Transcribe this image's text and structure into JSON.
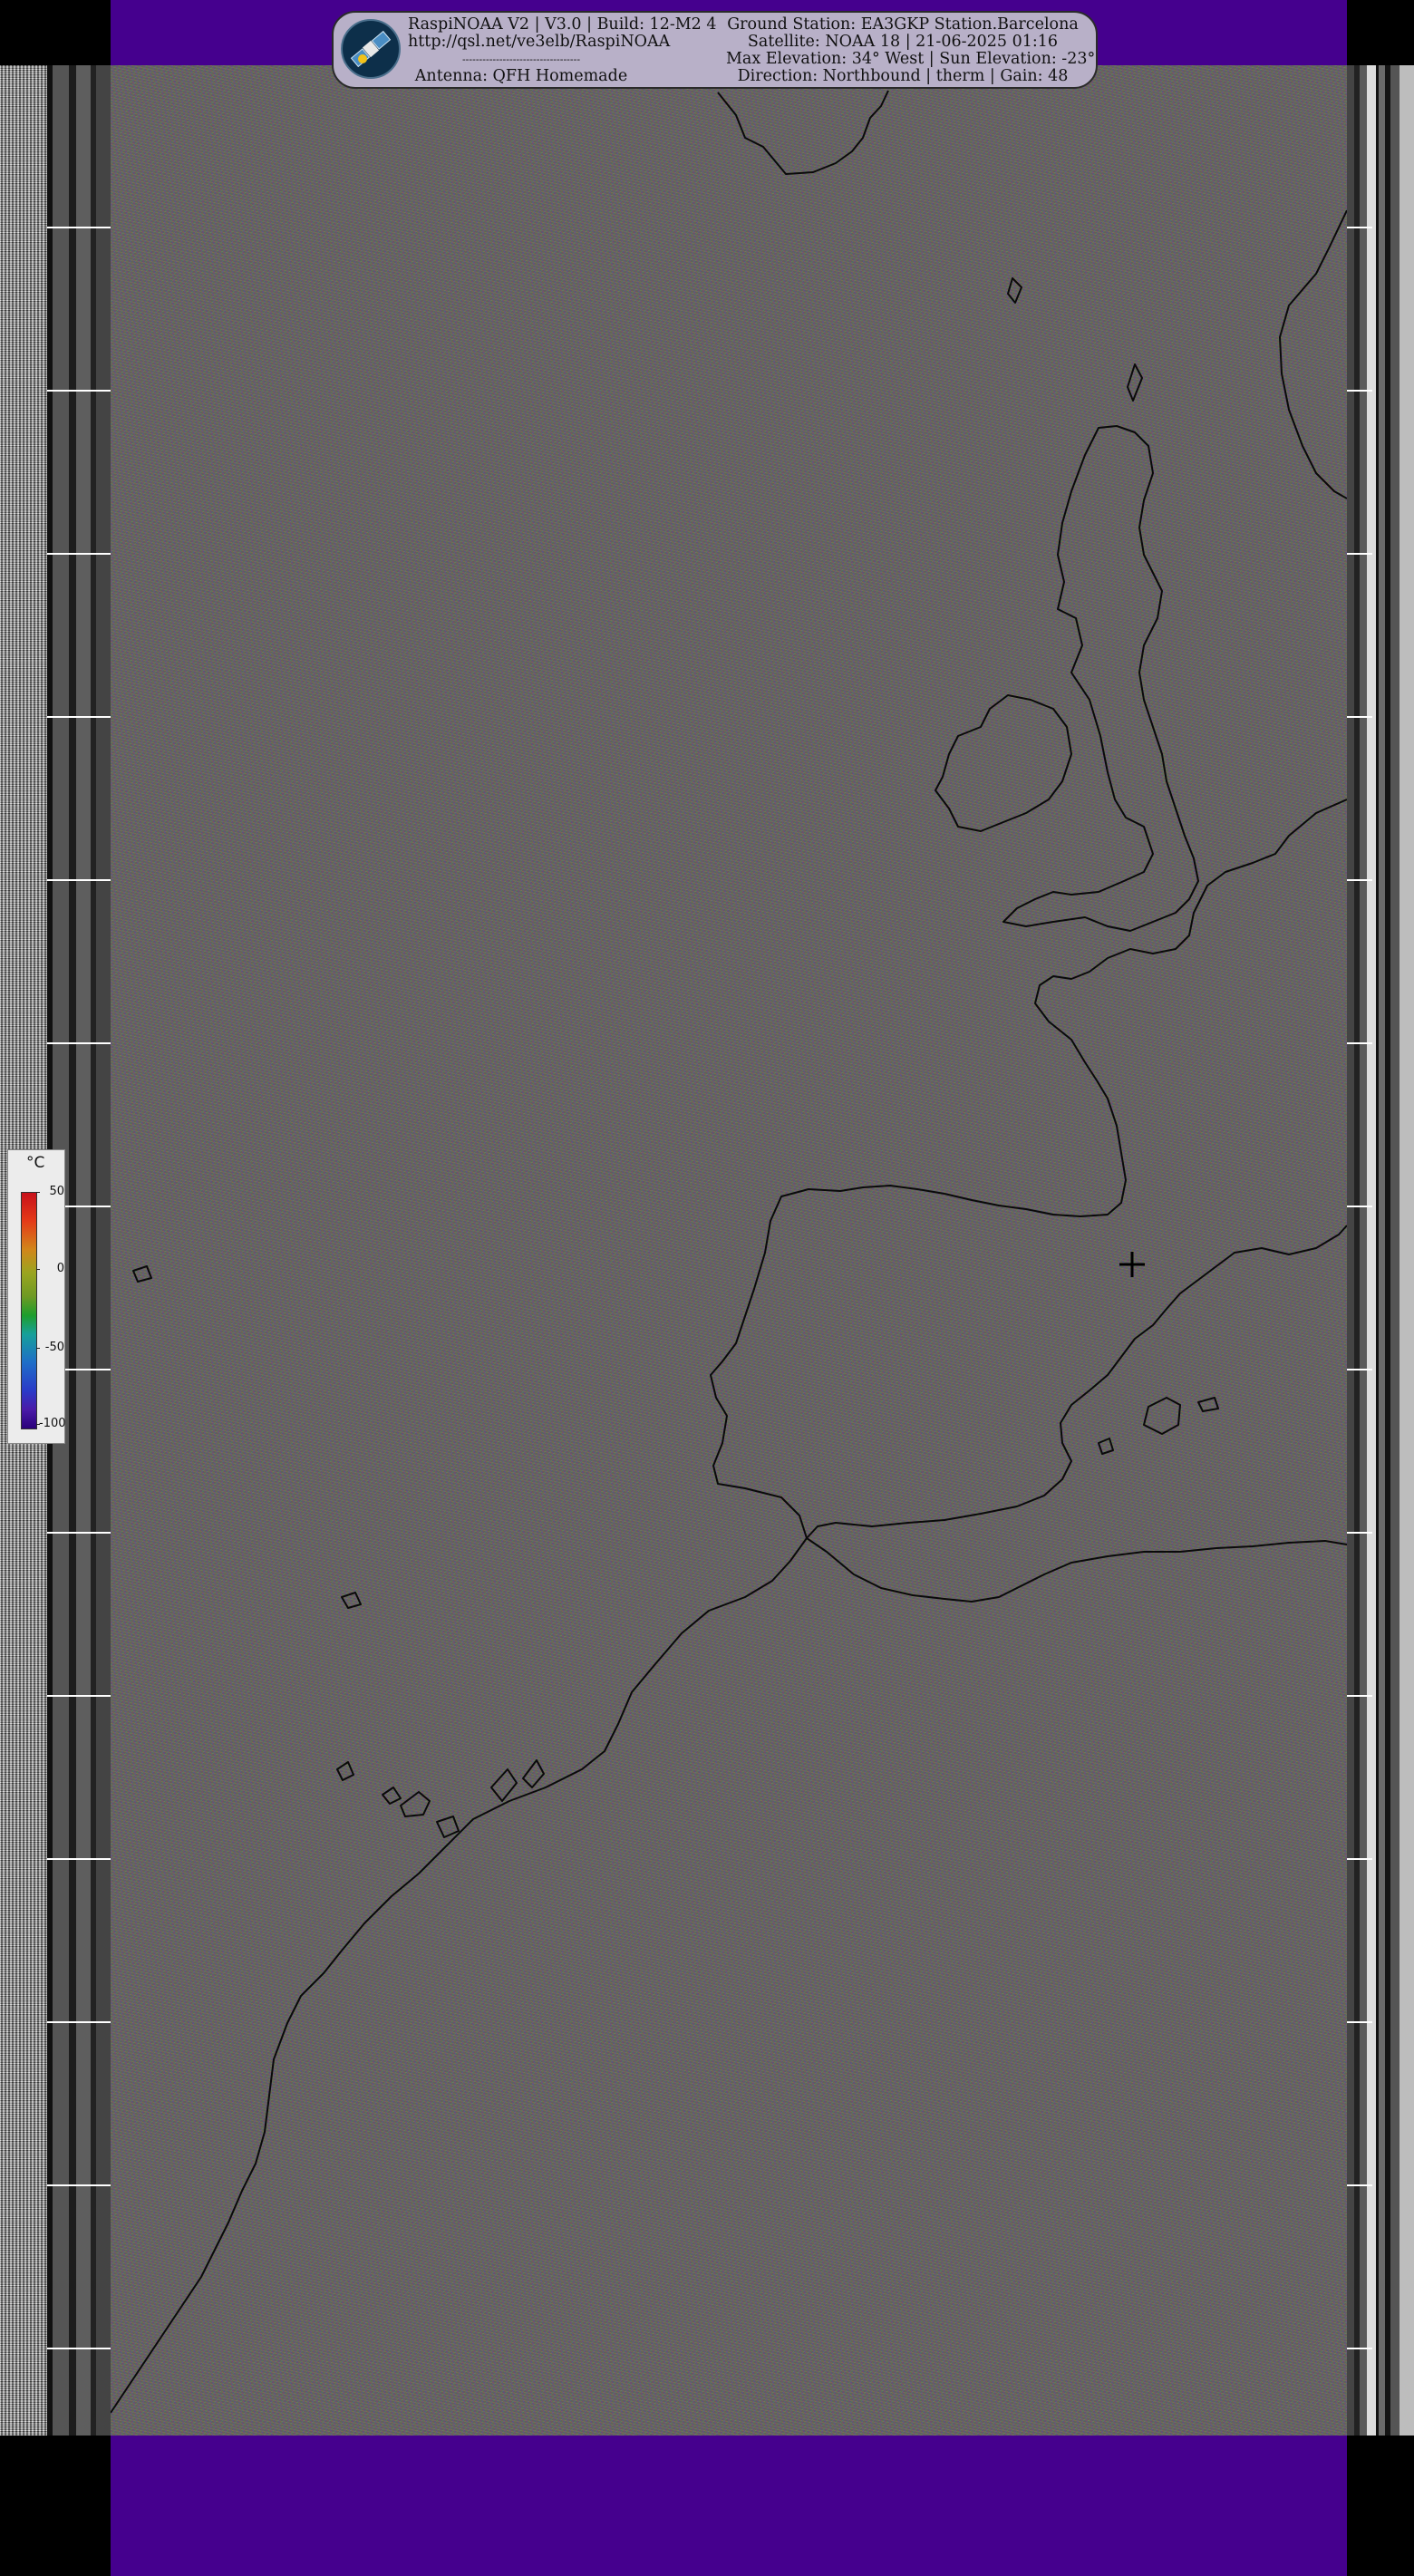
{
  "header": {
    "left_line_1": "RaspiNOAA V2 | V3.0 | Build: 12-M2 4",
    "left_line_2": "http://qsl.net/ve3elb/RaspiNOAA",
    "left_line_3": "-----------------------------------",
    "left_line_4": "Antenna: QFH Homemade",
    "right_line_1": "Ground Station: EA3GKP Station.Barcelona",
    "right_line_2": "Satellite: NOAA 18 | 21-06-2025 01:16",
    "right_line_3": "Max Elevation: 34° West | Sun Elevation: -23°",
    "right_line_4": "Direction: Northbound | therm | Gain: 48"
  },
  "legend": {
    "unit": "°C",
    "ticks": [
      "50",
      "0",
      "-50",
      "-100"
    ]
  },
  "colors": {
    "band_purple": "#45008e",
    "header_bubble": "#b8b0c8"
  },
  "icons": {
    "logo": "satellite-icon",
    "marker": "crosshair-icon"
  }
}
